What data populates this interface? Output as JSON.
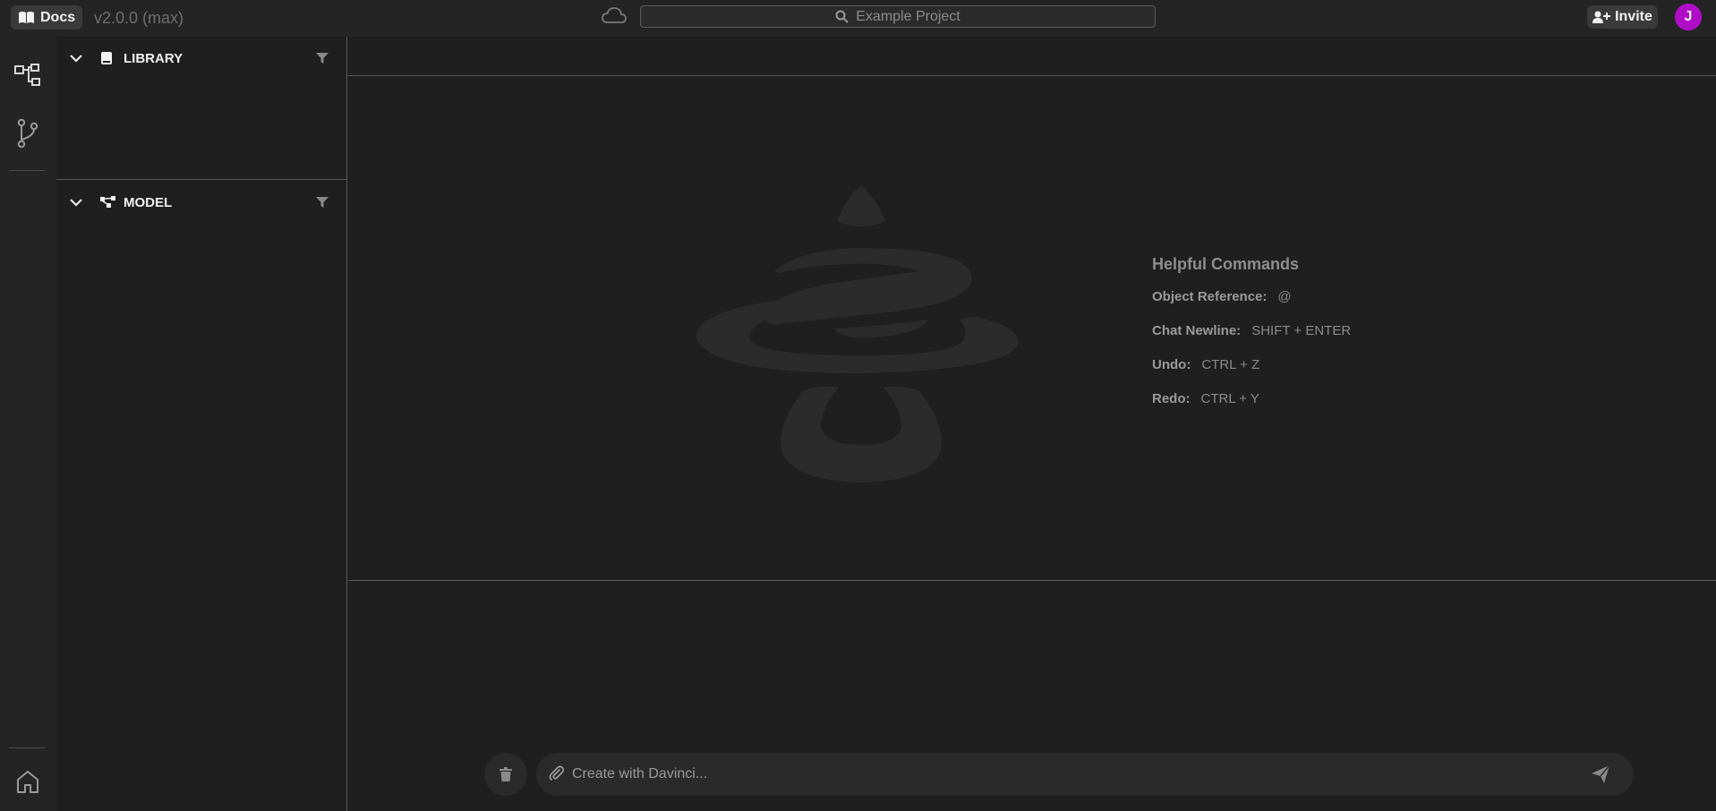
{
  "header": {
    "docs_label": "Docs",
    "version": "v2.0.0 (max)",
    "search_placeholder": "Example Project",
    "invite_label": "Invite",
    "avatar_initial": "J",
    "avatar_color": "#b10dc9"
  },
  "rail": {
    "items": [
      {
        "icon": "hierarchy-icon"
      },
      {
        "icon": "branch-icon"
      }
    ],
    "bottom_icon": "home-icon"
  },
  "panel": {
    "sections": [
      {
        "title": "LIBRARY",
        "icon": "book-icon",
        "expanded": true
      },
      {
        "title": "MODEL",
        "icon": "model-graph-icon",
        "expanded": true
      }
    ]
  },
  "commands": {
    "title": "Helpful Commands",
    "items": [
      {
        "label": "Object Reference:",
        "value": "@"
      },
      {
        "label": "Chat Newline:",
        "value": "SHIFT + ENTER"
      },
      {
        "label": "Undo:",
        "value": "CTRL + Z"
      },
      {
        "label": "Redo:",
        "value": "CTRL + Y"
      }
    ]
  },
  "chat": {
    "placeholder": "Create with Davinci..."
  }
}
